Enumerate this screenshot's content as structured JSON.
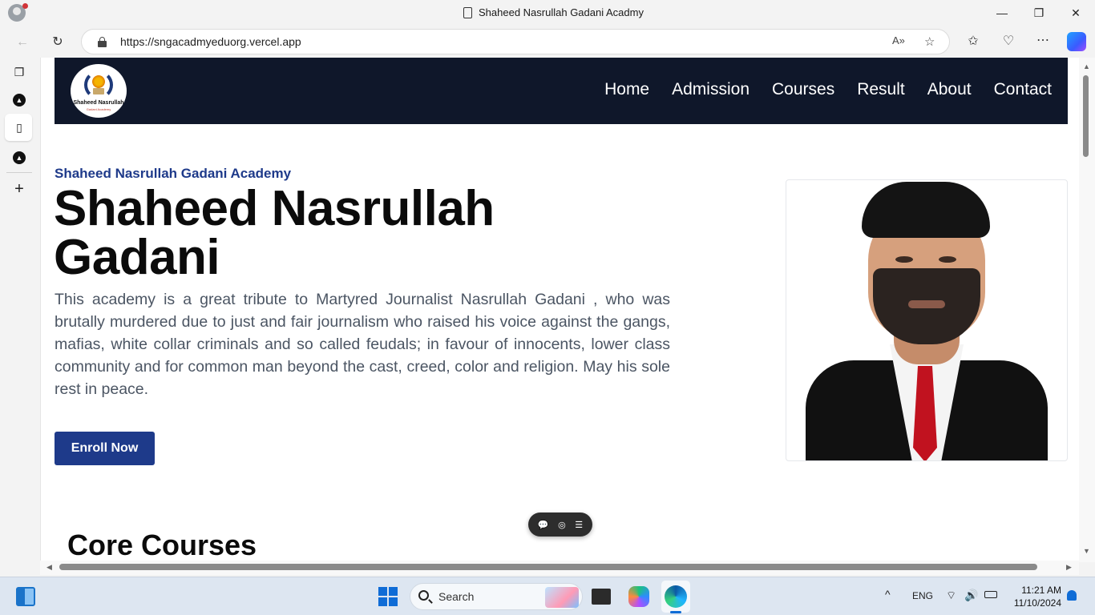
{
  "browser": {
    "tab_title": "Shaheed Nasrullah Gadani Acadmy",
    "url": "https://sngacadmyeduorg.vercel.app",
    "window_controls": {
      "minimize": "—",
      "restore": "❐",
      "close": "✕"
    }
  },
  "site": {
    "logo_text": "Shaheed Nasrullah",
    "logo_subtext": "Gadani Academy",
    "nav": [
      "Home",
      "Admission",
      "Courses",
      "Result",
      "About",
      "Contact"
    ],
    "eyebrow": "Shaheed Nasrullah Gadani Academy",
    "hero_title": "Shaheed Nasrullah Gadani",
    "hero_text": "This academy is a great tribute to Martyred Journalist Nasrullah Gadani , who was brutally murdered due to just and fair journalism who raised his voice against the gangs, mafias, white collar criminals and so called feudals; in favour of innocents, lower class community and for common man beyond the cast, creed, color and religion. May his sole rest in peace.",
    "enroll_label": "Enroll Now",
    "section_title": "Core Courses"
  },
  "taskbar": {
    "search_label": "Search",
    "language": "ENG",
    "time": "11:21 AM",
    "date": "11/10/2024"
  },
  "colors": {
    "navbar": "#0f172a",
    "accent": "#1e3a8a",
    "text_body": "#4b5563"
  }
}
